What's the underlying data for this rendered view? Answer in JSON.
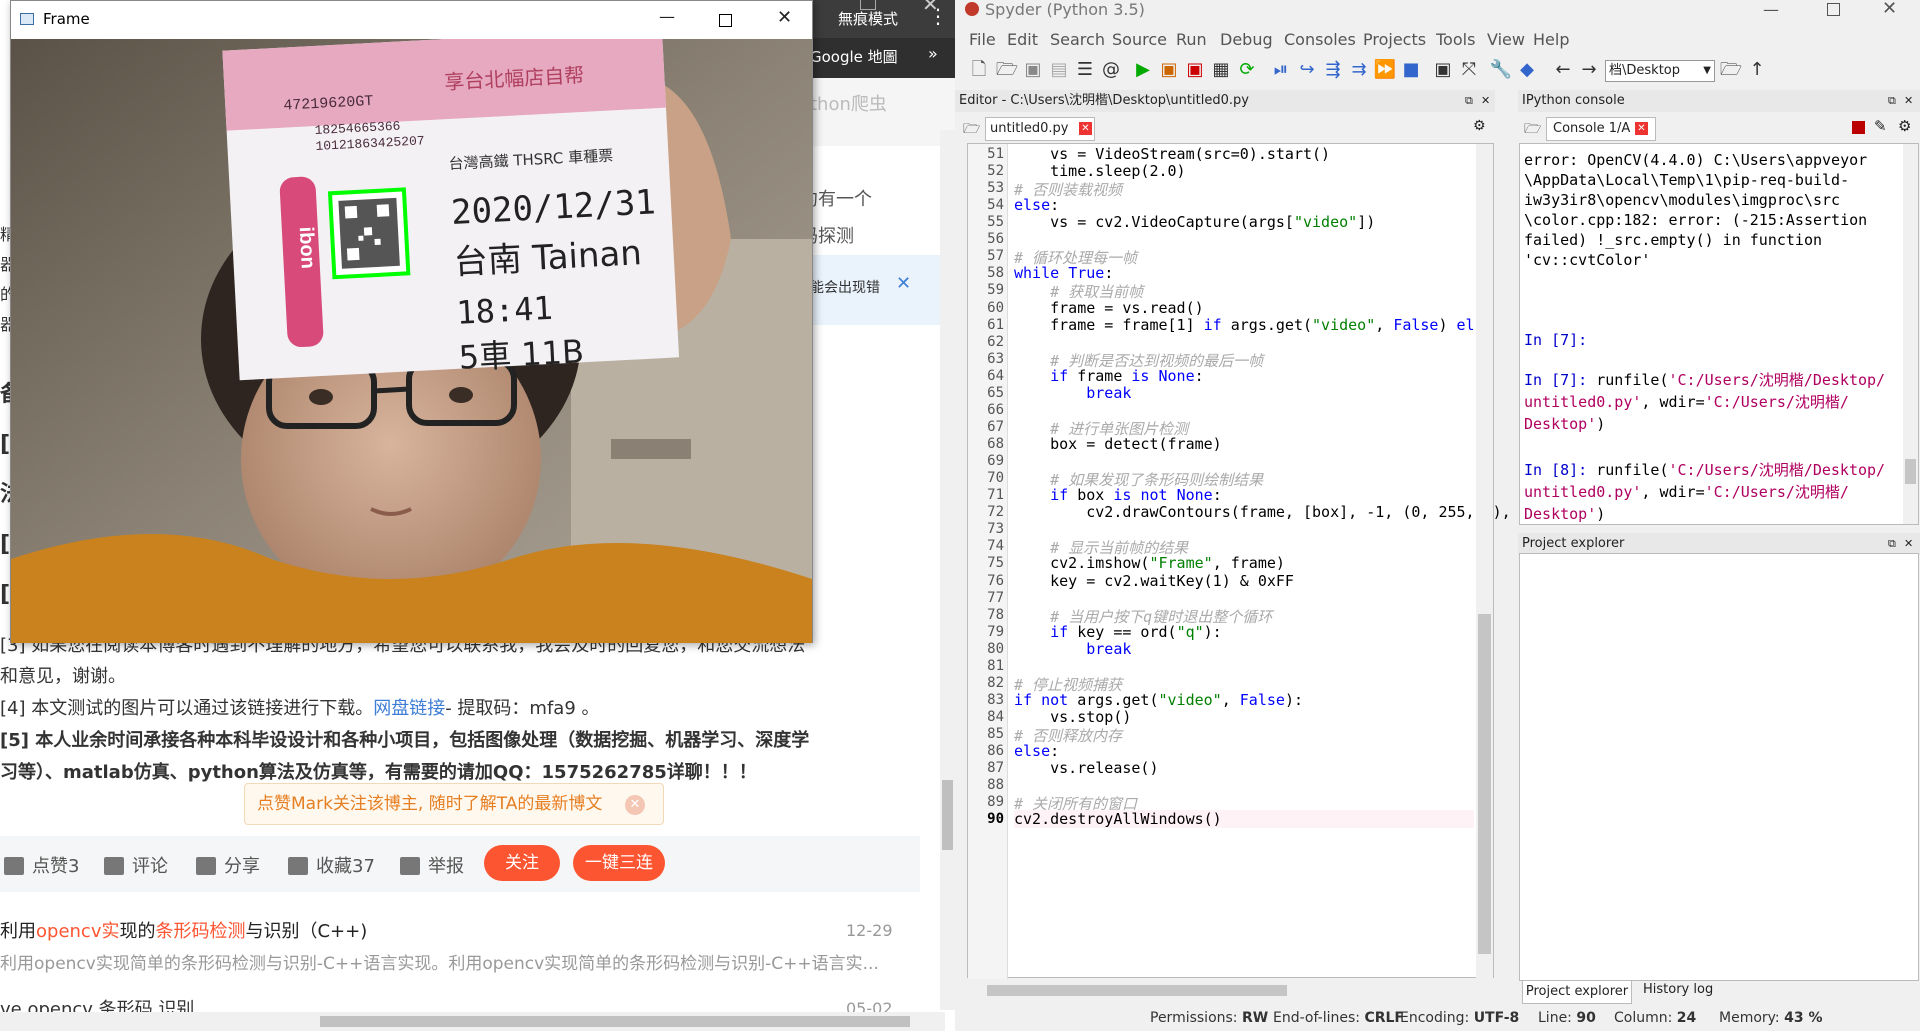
{
  "browser": {
    "top_button": "無痕模式",
    "bookmark": "Google 地圖",
    "tab_text": "thon爬虫",
    "snip1": "约有一个",
    "snip2": "码探测",
    "snip3": "能会出现错",
    "article": {
      "line1": "[3] 如果您在阅读本博客时遇到不理解的地方，希望您可以联系我，我会及时的回复您，和您交流想法",
      "line2": "和意见，谢谢。",
      "line3_pre": "[4] 本文测试的图片可以通过该链接进行下载。",
      "line3_link": "网盘链接",
      "line3_post": "- 提取码：mfa9 。",
      "line4": "[5] 本人业余时间承接各种本科毕设设计和各种小项目，包括图像处理（数据挖掘、机器学习、深度学",
      "line5": "习等）、matlab仿真、python算法及仿真等，有需要的请加QQ：1575262785详聊！！！"
    },
    "tip": "点赞Mark关注该博主, 随时了解TA的最新博文",
    "actions": {
      "like": "点赞3",
      "comment": "评论",
      "share": "分享",
      "favorite": "收藏37",
      "report": "举报",
      "follow": "关注",
      "triple": "一键三连"
    },
    "related": [
      {
        "title_a": "利用",
        "title_b": "opencv实",
        "title_c": "现的",
        "title_d": "条形码检测",
        "title_e": "与识别（C++)",
        "date": "12-29",
        "desc": "利用opencv实现简单的条形码检测与识别-C++语言实现。利用opencv实现简单的条形码检测与识别-C++语言实..."
      },
      {
        "title": "ve opencv 条形码 识别",
        "date": "05-02"
      }
    ]
  },
  "frame_window": {
    "title": "Frame",
    "ticket": {
      "date": "2020/12/31",
      "station": "台南 Tainan",
      "time": "18:41",
      "seat": "5車 11B",
      "header": "台灣高鐵 THSRC 車種票",
      "num1": "47219620GT",
      "num2": "18254665366",
      "num3": "10121863425207",
      "stamp": "享台北幅店自帮",
      "ibon": "ibon"
    }
  },
  "spyder": {
    "title": "Spyder (Python 3.5)",
    "menu": [
      "File",
      "Edit",
      "Search",
      "Source",
      "Run",
      "Debug",
      "Consoles",
      "Projects",
      "Tools",
      "View",
      "Help"
    ],
    "path_value": "档\\Desktop",
    "editor_header": "Editor - C:\\Users\\沈明楷\\Desktop\\untitled0.py",
    "editor_tab": "untitled0.py",
    "console_header": "IPython console",
    "console_tab": "Console 1/A",
    "project_header": "Project explorer",
    "bottom_tabs": [
      "Project explorer",
      "History log"
    ],
    "status": {
      "perm_label": "Permissions:",
      "perm": "RW",
      "eol_label": "End-of-lines:",
      "eol": "CRLF",
      "enc_label": "Encoding:",
      "enc": "UTF-8",
      "line_label": "Line:",
      "line": "90",
      "col_label": "Column:",
      "col": "24",
      "mem_label": "Memory:",
      "mem": "43 %"
    },
    "console_lines": [
      "error: OpenCV(4.4.0) C:\\Users\\appveyor",
      "\\AppData\\Local\\Temp\\1\\pip-req-build-",
      "iw3y3ir8\\opencv\\modules\\imgproc\\src",
      "\\color.cpp:182: error: (-215:Assertion",
      "failed) !_src.empty() in function",
      "'cv::cvtColor'"
    ],
    "in7a": "In [7]:",
    "in7b_prompt": "In [7]:",
    "in7b_code": " runfile(",
    "in7b_path1": "'C:/Users/沈明楷/Desktop/",
    "in7b_path2": "untitled0.py'",
    "in7b_mid": ", wdir=",
    "in7b_path3": "'C:/Users/沈明楷/",
    "in7b_path4": "Desktop'",
    "in7b_end": ")",
    "in8_prompt": "In [8]:",
    "in8_code": " runfile(",
    "in8_path1": "'C:/Users/沈明楷/Desktop/",
    "in8_path2": "untitled0.py'",
    "in8_mid": ", wdir=",
    "in8_path3": "'C:/Users/沈明楷/",
    "in8_path4": "Desktop'",
    "in8_end": ")"
  }
}
